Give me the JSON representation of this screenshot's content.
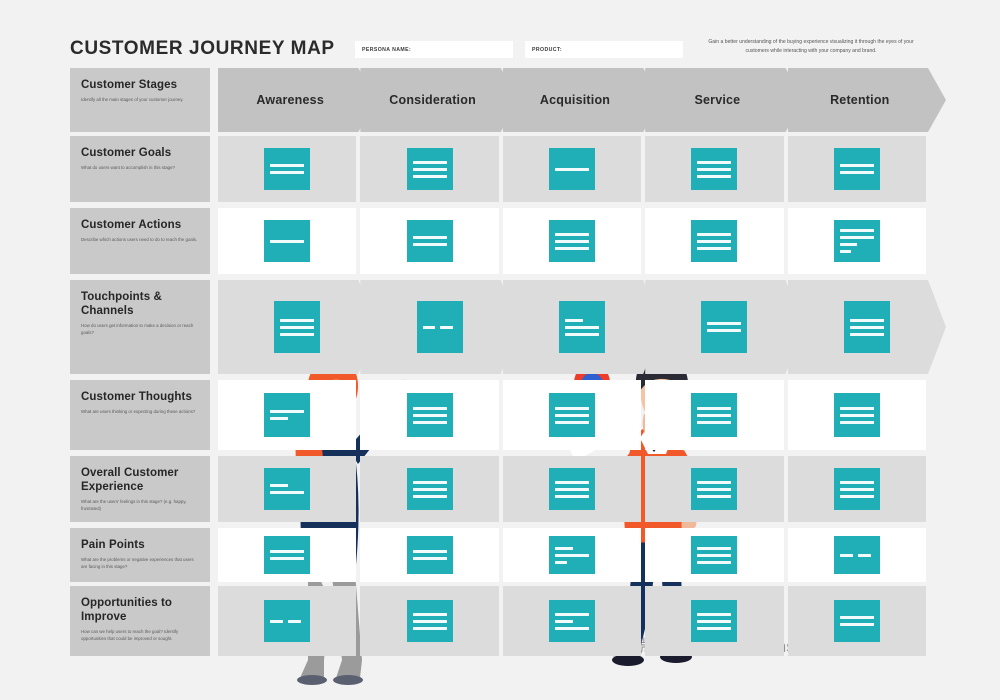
{
  "header": {
    "title": "CUSTOMER JOURNEY MAP",
    "persona_label": "PERSONA NAME:",
    "persona_value": "",
    "product_label": "PRODUCT:",
    "product_value": "",
    "description": "Gain a better understanding of the buying experience visualizing it through the eyes of your customers while interacting with your company and brand."
  },
  "stages": [
    {
      "label": "Awareness"
    },
    {
      "label": "Consideration"
    },
    {
      "label": "Acquisition"
    },
    {
      "label": "Service"
    },
    {
      "label": "Retention"
    }
  ],
  "rows": [
    {
      "title": "Customer Stages",
      "desc": "Identify all the main stages of your customer journey.",
      "style": "chevron-header"
    },
    {
      "title": "Customer Goals",
      "desc": "What do users want to accomplish in this stage?",
      "style": "gray"
    },
    {
      "title": "Customer Actions",
      "desc": "Describe which actions users need to do to reach the goals.",
      "style": "white"
    },
    {
      "title": "Touchpoints & Channels",
      "desc": "How do users get information to make a decision or reach goals?",
      "style": "chevron"
    },
    {
      "title": "Customer Thoughts",
      "desc": "What are users thinking or expecting during these actions?",
      "style": "white"
    },
    {
      "title": "Overall Customer Experience",
      "desc": "What are the users' feelings in this stage? (e.g. happy, frustrated)",
      "style": "gray"
    },
    {
      "title": "Pain Points",
      "desc": "What are the problems or negative experiences that users are facing in this stage?",
      "style": "white"
    },
    {
      "title": "Opportunities to Improve",
      "desc": "How can we help users to reach the goal? Identify opportunities that could be improved or sought.",
      "style": "gray"
    }
  ],
  "colors": {
    "accent_teal": "#21afb7",
    "page_background": "#f2f2f2",
    "label_card": "#c9c9c9",
    "row_gray": "#dcdcdc",
    "row_white": "#ffffff",
    "chevron_header": "#c2c2c2",
    "hair_orange": "#f2592a",
    "navy": "#16305c",
    "gray_pants": "#9b9b9b"
  },
  "watermark": {
    "icon": "wechat-icon",
    "text": "微信号: georgechenshanghai"
  }
}
